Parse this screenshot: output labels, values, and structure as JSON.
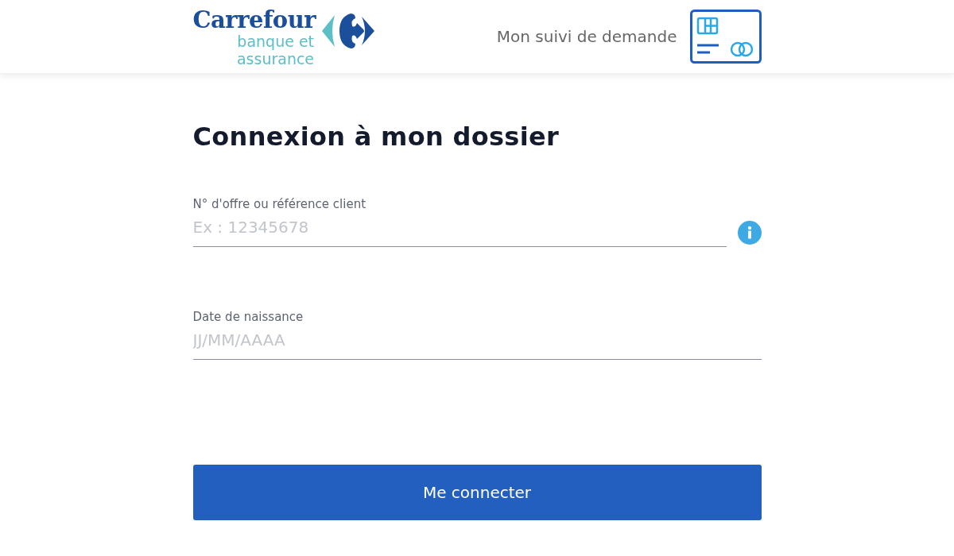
{
  "header": {
    "logo": {
      "brand": "Carrefour",
      "tagline_1": "banque et",
      "tagline_2": "assurance"
    },
    "tracking_link": "Mon suivi de demande"
  },
  "form": {
    "title": "Connexion à mon dossier",
    "fields": [
      {
        "label": "N° d'offre ou référence client",
        "placeholder": "Ex : 12345678",
        "kind": "info"
      },
      {
        "label": "Date de naissance",
        "placeholder": "JJ/MM/AAAA",
        "kind": "plain"
      }
    ],
    "submit": "Me connecter"
  }
}
